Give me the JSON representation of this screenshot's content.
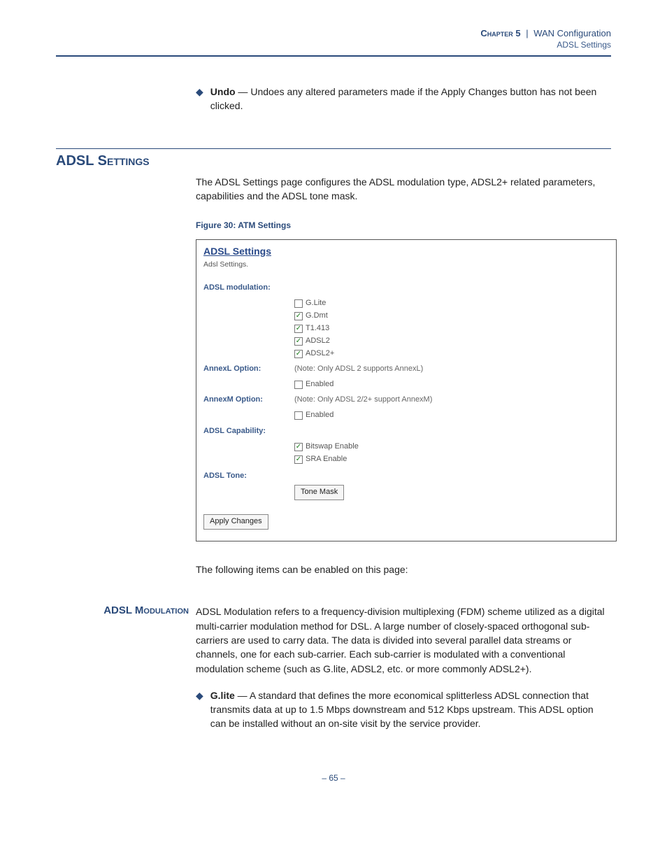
{
  "header": {
    "chapter": "Chapter 5",
    "separator": "|",
    "section": "WAN Configuration",
    "subsection": "ADSL Settings"
  },
  "undo": {
    "bullet": "◆",
    "term": "Undo",
    "dash": " — ",
    "desc": "Undoes any altered parameters made if the Apply Changes button has not been clicked."
  },
  "section_heading": "ADSL Settings",
  "intro_text": "The ADSL Settings page configures the ADSL modulation type, ADSL2+ related parameters, capabilities and the ADSL tone mask.",
  "figure_caption": "Figure 30:  ATM Settings",
  "screenshot": {
    "title": "ADSL Settings",
    "subtitle": "Adsl Settings.",
    "modulation_label": "ADSL modulation:",
    "modulation_options": [
      {
        "label": "G.Lite",
        "checked": false
      },
      {
        "label": "G.Dmt",
        "checked": true
      },
      {
        "label": "T1.413",
        "checked": true
      },
      {
        "label": "ADSL2",
        "checked": true
      },
      {
        "label": "ADSL2+",
        "checked": true
      }
    ],
    "annexl_label": "AnnexL Option:",
    "annexl_note": "(Note: Only ADSL 2 supports AnnexL)",
    "annexl_cb": {
      "label": "Enabled",
      "checked": false
    },
    "annexm_label": "AnnexM Option:",
    "annexm_note": "(Note: Only ADSL 2/2+ support AnnexM)",
    "annexm_cb": {
      "label": "Enabled",
      "checked": false
    },
    "capability_label": "ADSL Capability:",
    "capability_options": [
      {
        "label": "Bitswap Enable",
        "checked": true
      },
      {
        "label": "SRA Enable",
        "checked": true
      }
    ],
    "tone_label": "ADSL Tone:",
    "tone_button": "Tone Mask",
    "apply_button": "Apply Changes"
  },
  "following_text": "The following items can be enabled on this page:",
  "adsl_mod": {
    "heading": "ADSL Modulation",
    "body": "ADSL Modulation refers to a frequency-division multiplexing (FDM) scheme utilized as a digital multi-carrier modulation method for DSL. A large number of closely-spaced orthogonal sub-carriers are used to carry data. The data is divided into several parallel data streams or channels, one for each sub-carrier. Each sub-carrier is modulated with a conventional modulation scheme (such as G.lite, ADSL2, etc. or more commonly ADSL2+).",
    "bullet": "◆",
    "glite_term": "G.lite",
    "glite_dash": " — ",
    "glite_desc": "A standard that defines the more economical splitterless ADSL connection that transmits data at up to 1.5 Mbps downstream and 512 Kbps upstream. This ADSL option can be installed without an on-site visit by the service provider."
  },
  "page_number": "–  65  –"
}
